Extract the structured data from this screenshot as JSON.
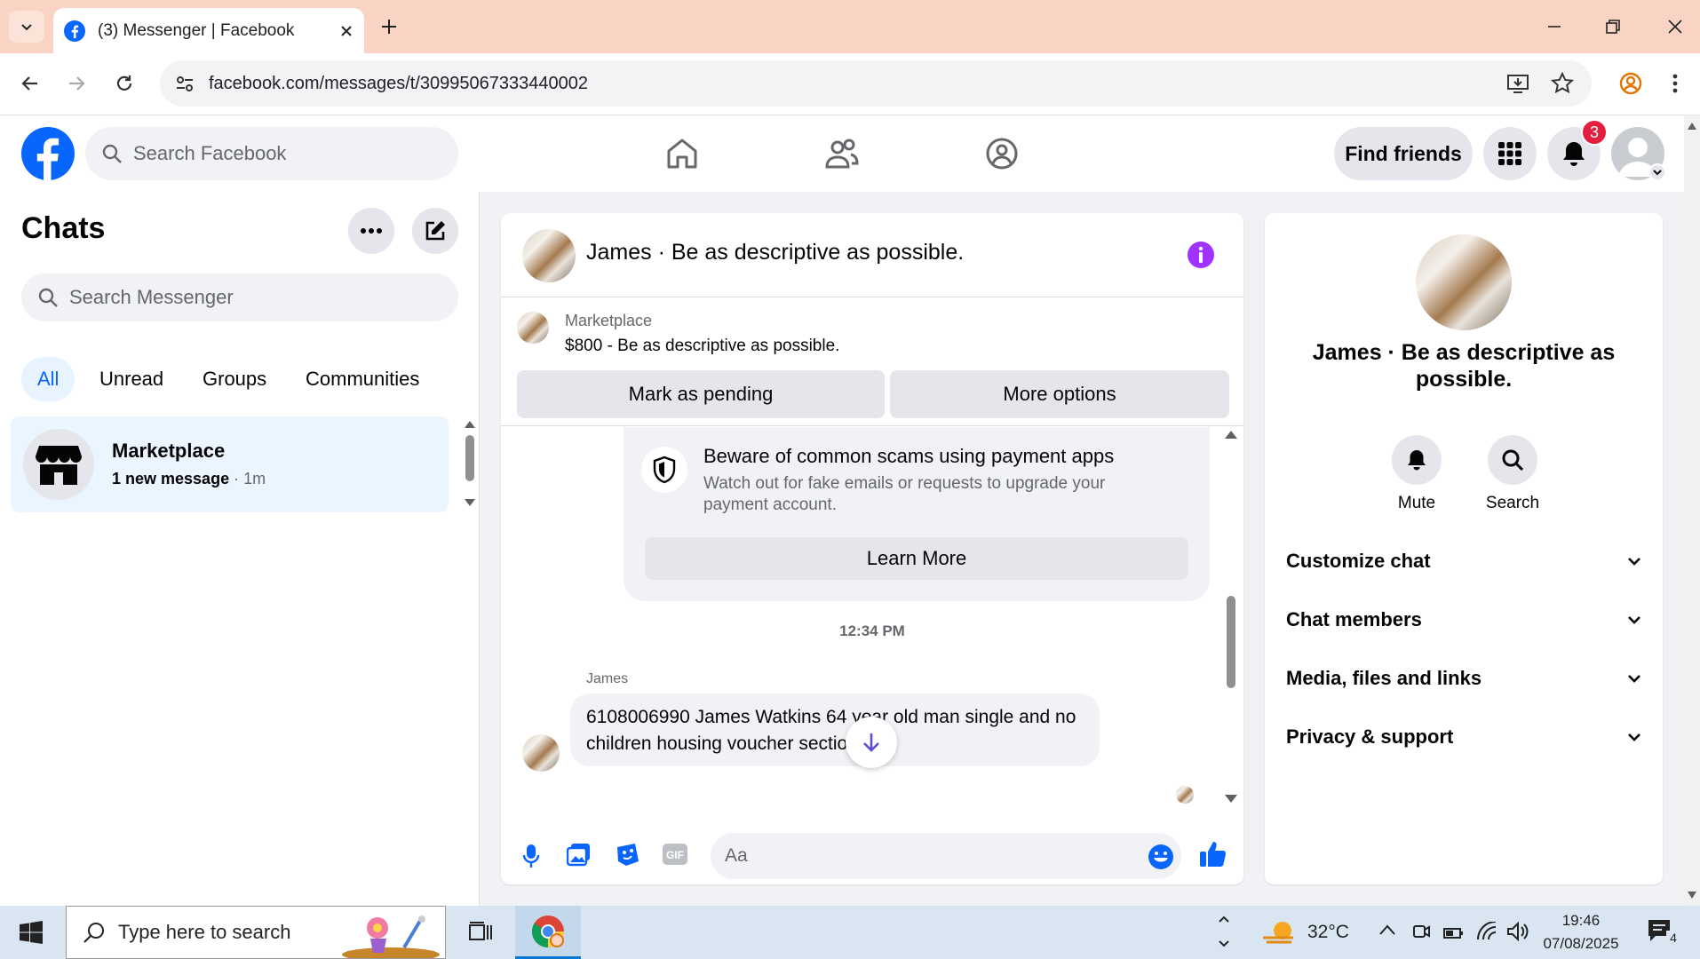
{
  "browser": {
    "tab_title": "(3) Messenger | Facebook",
    "url": "facebook.com/messages/t/30995067333440002"
  },
  "header": {
    "search_placeholder": "Search Facebook",
    "find_friends": "Find friends",
    "notif_count": "3"
  },
  "left": {
    "title": "Chats",
    "search_placeholder": "Search Messenger",
    "filters": [
      "All",
      "Unread",
      "Groups",
      "Communities"
    ],
    "conversation": {
      "name": "Marketplace",
      "preview": "1 new message",
      "time": " · 1m"
    }
  },
  "chat": {
    "title": "James · Be as descriptive as possible.",
    "marketplace": {
      "label": "Marketplace",
      "listing": "$800 - Be as descriptive as possible.",
      "pending": "Mark as pending",
      "more": "More options"
    },
    "scam": {
      "title": "Beware of common scams using payment apps",
      "desc": "Watch out for fake emails or requests to upgrade your payment account.",
      "learn": "Learn More"
    },
    "time": "12:34 PM",
    "sender": "James",
    "message": "6108006990 James Watkins 64 year old man single and no children housing voucher section 8",
    "input_placeholder": "Aa"
  },
  "right": {
    "name": "James · Be as descriptive as possible.",
    "mute": "Mute",
    "search": "Search",
    "sections": [
      "Customize chat",
      "Chat members",
      "Media, files and links",
      "Privacy & support"
    ]
  },
  "taskbar": {
    "search": "Type here to search",
    "weather": "32°C",
    "time": "19:46",
    "date": "07/08/2025",
    "notif": "4"
  },
  "colors": {
    "fb_blue": "#0866ff",
    "messenger_purple": "#a033ff",
    "badge_red": "#e41e3f"
  }
}
